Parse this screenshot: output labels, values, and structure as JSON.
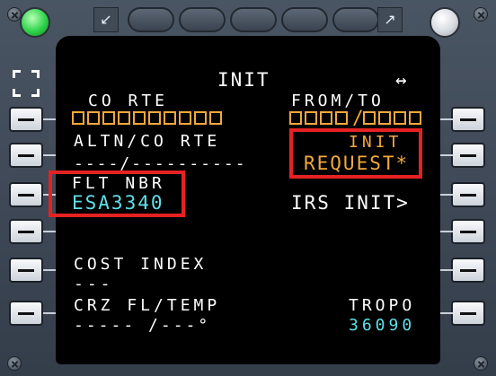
{
  "screen": {
    "title": "INIT",
    "arrows": "↔",
    "left": {
      "co_rte_label": "CO RTE",
      "altn_label": "ALTN/CO RTE",
      "altn_value": "----/----------",
      "flt_nbr_label": "FLT NBR",
      "flt_nbr_value": "ESA3340",
      "cost_index_label": "COST INDEX",
      "cost_index_value": "---",
      "crz_label": "CRZ FL/TEMP",
      "crz_value": "----- /---°"
    },
    "right": {
      "from_to_label": "FROM/TO",
      "init_label": "INIT",
      "request_value": "REQUEST*",
      "irs_init": "IRS INIT>",
      "tropo_label": "TROPO",
      "tropo_value": "36090"
    }
  },
  "icons": {
    "led_left": "green-led-icon",
    "led_right": "white-led-icon",
    "resize_left": "shrink-arrows-icon",
    "resize_right": "expand-arrows-icon",
    "focus": "focus-frame-icon"
  },
  "colors": {
    "white": "#ffffff",
    "amber": "#f2a93b",
    "cyan": "#5fe0e8",
    "highlight": "#e52222"
  }
}
